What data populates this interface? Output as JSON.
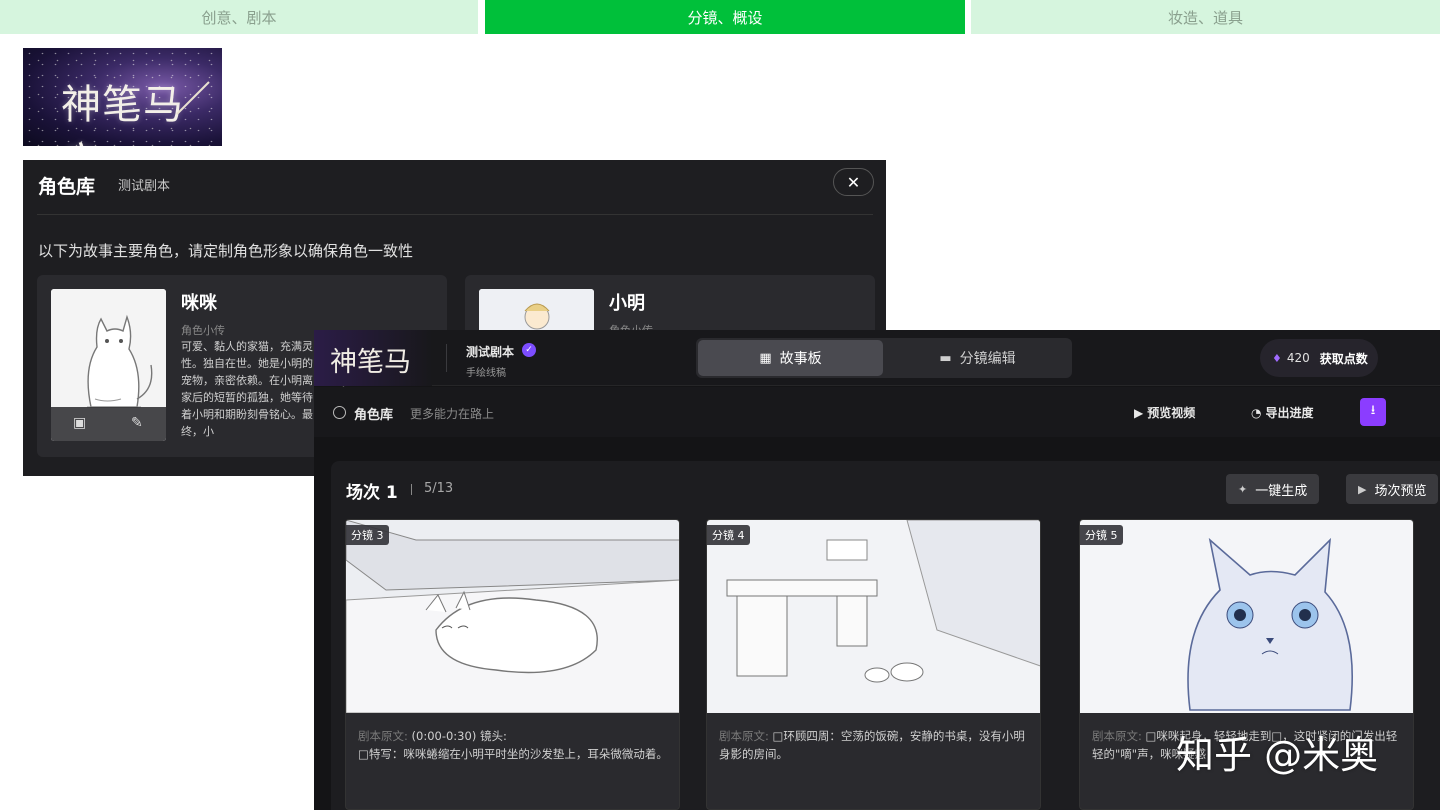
{
  "top_tabs": [
    {
      "label": "创意、剧本"
    },
    {
      "label": "分镜、概设"
    },
    {
      "label": "妆造、道具"
    }
  ],
  "logo": {
    "text": "神笔马良"
  },
  "character_panel": {
    "title": "角色库",
    "subtitle": "测试剧本",
    "close": "✕",
    "intro": "以下为故事主要角色，请定制角色形象以确保角色一致性",
    "characters": [
      {
        "name": "咪咪",
        "role": "角色小传",
        "desc": "可爱、黏人的家猫，充满灵性。独自在世。她是小明的宠物，亲密依赖。在小明离家后的短暂的孤独，她等待着小明和期盼刻骨铭心。最终，小"
      },
      {
        "name": "小明",
        "role": "角色小传",
        "desc": ""
      }
    ]
  },
  "app": {
    "logo_text": "神笔马良",
    "project_name": "测试剧本",
    "project_style": "手绘线稿",
    "modes": [
      {
        "label": "故事板",
        "icon": "grid-icon"
      },
      {
        "label": "分镜编辑",
        "icon": "list-icon"
      }
    ],
    "points_value": "420",
    "points_label": "获取点数",
    "role_label": "角色库",
    "role_hint": "更多能力在路上",
    "preview_video": "预览视频",
    "export_progress": "导出进度",
    "scene": {
      "title": "场次 1",
      "count": "5/13",
      "generate": "一键生成",
      "preview": "场次预览"
    },
    "shots": [
      {
        "badge": "分镜 3",
        "label": "剧本原文:",
        "text": " (0:00-0:30) 镜头:\n□特写：咪咪蜷缩在小明平时坐的沙发垫上，耳朵微微动着。"
      },
      {
        "badge": "分镜 4",
        "label": "剧本原文:",
        "text": " □环顾四周：空荡的饭碗，安静的书桌，没有小明身影的房间。"
      },
      {
        "badge": "分镜 5",
        "label": "剧本原文:",
        "text": " □咪咪起身，轻轻地走到□，这时紧闭的门发出轻轻的\"嘀\"声，咪咪疑惑"
      }
    ]
  },
  "watermark": "知乎 @米奥"
}
